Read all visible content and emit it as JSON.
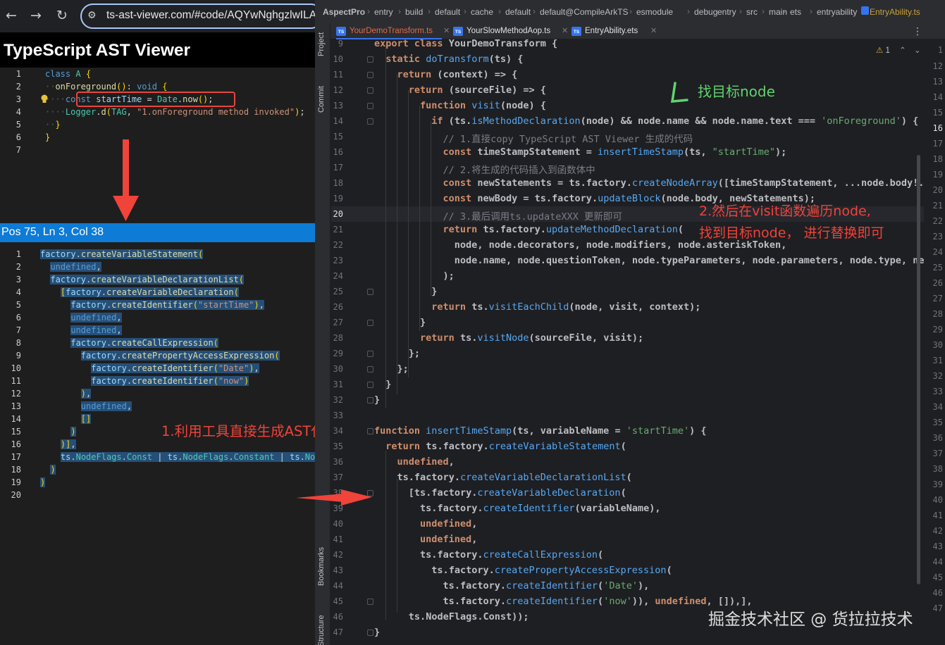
{
  "browser": {
    "url": "ts-ast-viewer.com/#code/AQYwNghgzlwILAN",
    "back_icon": "arrow-left-icon",
    "forward_icon": "arrow-right-icon",
    "reload_icon": "reload-icon",
    "tune_icon": "site-settings-icon"
  },
  "viewer": {
    "title": "TypeScript AST Viewer",
    "source_line_numbers": [
      "1",
      "2",
      "3",
      "4",
      "5",
      "6",
      "7"
    ],
    "source_lines": [
      "class A {",
      "  onForeground(): void {",
      "    const startTime = Date.now();",
      "    Logger.d(TAG, \"1.onForeground method invoked\");",
      "  }",
      "}",
      ""
    ],
    "status": "Pos 75, Ln 3, Col 38",
    "factory_line_numbers": [
      "1",
      "2",
      "3",
      "4",
      "5",
      "6",
      "7",
      "8",
      "9",
      "10",
      "11",
      "12",
      "13",
      "14",
      "15",
      "16",
      "17",
      "18",
      "19",
      "20"
    ],
    "factory_lines": [
      "factory.createVariableStatement(",
      "  undefined,",
      "  factory.createVariableDeclarationList(",
      "    [factory.createVariableDeclaration(",
      "      factory.createIdentifier(\"startTime\"),",
      "      undefined,",
      "      undefined,",
      "      factory.createCallExpression(",
      "        factory.createPropertyAccessExpression(",
      "          factory.createIdentifier(\"Date\"),",
      "          factory.createIdentifier(\"now\")",
      "        ),",
      "        undefined,",
      "        []",
      "      )",
      "    )],",
      "    ts.NodeFlags.Const | ts.NodeFlags.Constant | ts.No",
      "  )",
      ")",
      ""
    ]
  },
  "annotations": {
    "step1": "1.利用工具直接生成AST代码",
    "find_node": "找目标node",
    "step2_line1": "2.然后在visit函数遍历node,",
    "step2_line2": "找到目标node， 进行替换即可",
    "watermark": "掘金技术社区 @ 货拉拉技术",
    "arrow_color": "#f0433a",
    "check_color": "#5fd36e"
  },
  "ide": {
    "breadcrumbs": [
      "AspectPro",
      "entry",
      "build",
      "default",
      "cache",
      "default",
      "default@CompileArkTS",
      "esmodule",
      "debug",
      "entry",
      "src",
      "main",
      "ets",
      "entryability",
      "EntryAbility.ts"
    ],
    "tabs": [
      {
        "label": "YourDemoTransform.ts",
        "active": true
      },
      {
        "label": "YourSlowMethodAop.ts",
        "active": false
      },
      {
        "label": "EntryAbility.ets",
        "active": false
      }
    ],
    "side_labels": [
      "Project",
      "Commit",
      "Bookmarks",
      "Structure"
    ],
    "warning_count": "1",
    "current_line": "20",
    "line_numbers": [
      "9",
      "10",
      "11",
      "12",
      "13",
      "14",
      "15",
      "16",
      "17",
      "18",
      "19",
      "20",
      "21",
      "22",
      "23",
      "24",
      "25",
      "26",
      "27",
      "28",
      "29",
      "30",
      "31",
      "32",
      "33",
      "34",
      "35",
      "36",
      "37",
      "38",
      "39",
      "40",
      "41",
      "42",
      "43",
      "44",
      "45",
      "46",
      "47"
    ],
    "right_line_numbers": [
      "1",
      "12",
      "13",
      "14",
      "15",
      "16",
      "17",
      "18",
      "19",
      "20",
      "21",
      "22",
      "23",
      "24",
      "25",
      "26",
      "27",
      "28",
      "29",
      "30",
      "31",
      "32",
      "33",
      "34",
      "35",
      "36",
      "37",
      "38",
      "39",
      "40",
      "41",
      "42",
      "43",
      "44",
      "45",
      "46",
      "47"
    ],
    "code": [
      "export class YourDemoTransform {",
      "  static doTransform(ts) {",
      "    return (context) => {",
      "      return (sourceFile) => {",
      "        function visit(node) {",
      "          if (ts.isMethodDeclaration(node) && node.name && node.name.text === 'onForeground') {",
      "            // 1.直接copy TypeScript AST Viewer 生成的代码",
      "            const timeStampStatement = insertTimeStamp(ts, \"startTime\");",
      "            // 2.将生成的代码插入到函数体中",
      "            const newStatements = ts.factory.createNodeArray([timeStampStatement, ...node.body!.stat",
      "            const newBody = ts.factory.updateBlock(node.body, newStatements);",
      "            // 3.最后调用ts.updateXXX 更新即可",
      "            return ts.factory.updateMethodDeclaration(",
      "              node, node.decorators, node.modifiers, node.asteriskToken,",
      "              node.name, node.questionToken, node.typeParameters, node.parameters, node.type, newBod",
      "            );",
      "          }",
      "          return ts.visitEachChild(node, visit, context);",
      "        }",
      "        return ts.visitNode(sourceFile, visit);",
      "      };",
      "    };",
      "  }",
      "}",
      "",
      "function insertTimeStamp(ts, variableName = 'startTime') {",
      "  return ts.factory.createVariableStatement(",
      "    undefined,",
      "    ts.factory.createVariableDeclarationList(",
      "      [ts.factory.createVariableDeclaration(",
      "        ts.factory.createIdentifier(variableName),",
      "        undefined,",
      "        undefined,",
      "        ts.factory.createCallExpression(",
      "          ts.factory.createPropertyAccessExpression(",
      "            ts.factory.createIdentifier('Date'),",
      "            ts.factory.createIdentifier('now')), undefined, []),],",
      "      ts.NodeFlags.Const));",
      "}"
    ]
  }
}
